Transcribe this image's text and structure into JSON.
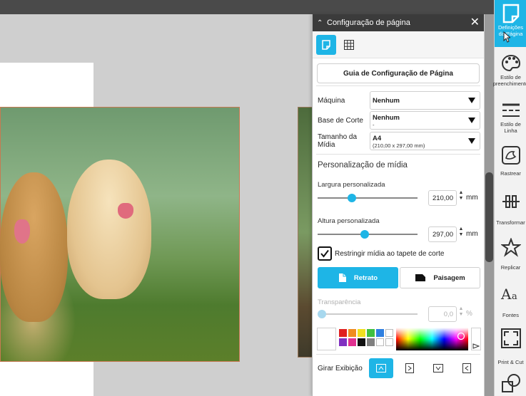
{
  "panel": {
    "title": "Configuração de página",
    "close": "✕",
    "guide_button": "Guia de Configuração de Página",
    "machine": {
      "label": "Máquina",
      "value": "Nenhum"
    },
    "cut_base": {
      "label": "Base de Corte",
      "value": "Nenhum",
      "sub": "-"
    },
    "media_size": {
      "label": "Tamanho da Mídia",
      "value": "A4",
      "sub": "(210,00 x 297,00 mm)"
    },
    "customization_title": "Personalização de mídia",
    "width": {
      "label": "Largura personalizada",
      "value": "210,00",
      "unit": "mm",
      "slider_level": 0.33
    },
    "height": {
      "label": "Altura personalizada",
      "value": "297,00",
      "unit": "mm",
      "slider_level": 0.47
    },
    "restrict_label": "Restringir mídia ao tapete de corte",
    "restrict_checked": true,
    "portrait": "Retrato",
    "landscape": "Paisagem",
    "transparency": {
      "label": "Transparência",
      "value": "0,0",
      "unit": "%",
      "slider_level": 0.0
    },
    "rotate_label": "Girar Exibição",
    "swatches": [
      "#e02020",
      "#f08c20",
      "#f0e020",
      "#40c040",
      "#3080e0",
      "#ffffff",
      "#8030c0",
      "#e03090",
      "#101010",
      "#808080",
      "#ffffff",
      "#ffffff"
    ]
  },
  "toolbar": {
    "items": [
      {
        "label": "Definições da Página",
        "icon": "page-settings-icon",
        "active": true
      },
      {
        "label": "Estilo de preenchimento",
        "icon": "palette-icon",
        "active": false
      },
      {
        "label": "Estilo de Linha",
        "icon": "line-style-icon",
        "active": false
      },
      {
        "label": "Rastrear",
        "icon": "trace-icon",
        "active": false
      },
      {
        "label": "Transformar",
        "icon": "transform-icon",
        "active": false
      },
      {
        "label": "Replicar",
        "icon": "replicate-icon",
        "active": false
      },
      {
        "label": "Fontes",
        "icon": "fonts-icon",
        "active": false
      },
      {
        "label": "Print & Cut",
        "icon": "print-cut-icon",
        "active": false
      }
    ]
  },
  "colors": {
    "accent": "#1eb5e6",
    "header": "#3b3b3b"
  }
}
